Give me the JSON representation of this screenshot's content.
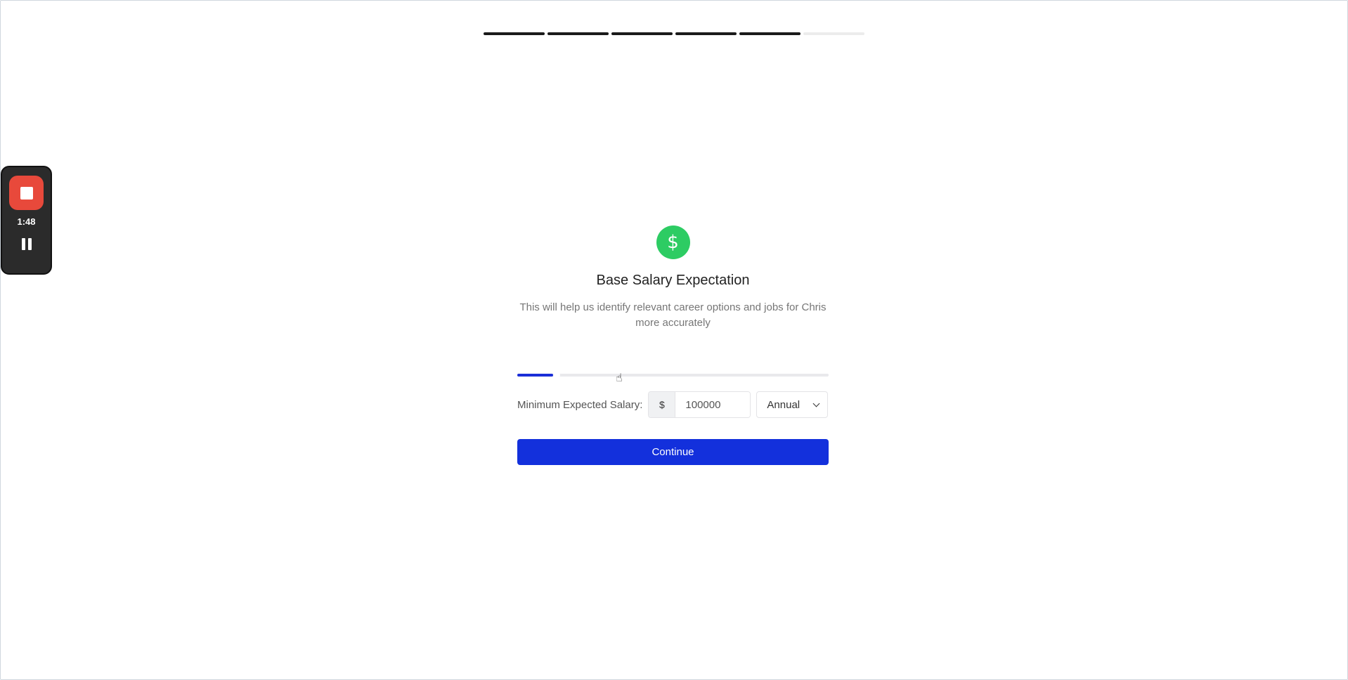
{
  "progress": {
    "total_steps": 6,
    "completed_steps": 5
  },
  "recorder": {
    "elapsed": "1:48",
    "stop_color": "#e8493b"
  },
  "card": {
    "icon": "dollar-icon",
    "icon_symbol": "$",
    "icon_color": "#2dcc63",
    "title": "Base Salary Expectation",
    "subtitle": "This will help us identify relevant career options and jobs for Chris more accurately"
  },
  "slider": {
    "fill_fraction": 0.115,
    "fill_color": "#1b2fd8"
  },
  "salary": {
    "label": "Minimum Expected Salary:",
    "currency_symbol": "$",
    "value": "100000",
    "period": "Annual"
  },
  "actions": {
    "continue_label": "Continue",
    "continue_color": "#1330dc"
  }
}
